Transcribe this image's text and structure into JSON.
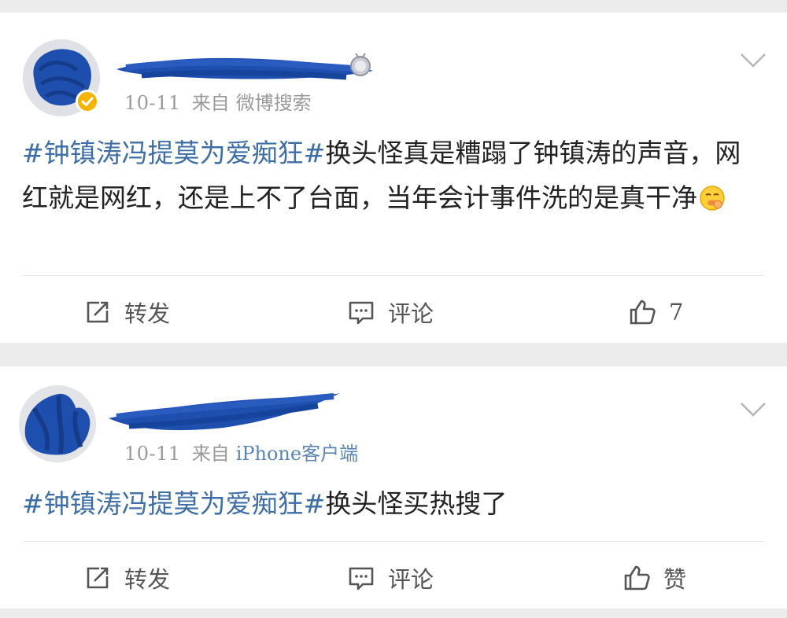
{
  "posts": [
    {
      "time": "10-11",
      "from_label": "来自",
      "source": "微博搜索",
      "content_tag": "#钟镇涛冯提莫为爱痴狂#",
      "content_text": "换头怪真是糟蹋了钟镇涛的声音，网红就是网红，还是上不了台面，当年会计事件洗的是真干净",
      "actions": {
        "repost": "转发",
        "comment": "评论",
        "like": "7"
      }
    },
    {
      "time": "10-11",
      "from_label": "来自",
      "source": "iPhone客户端",
      "content_tag": "#钟镇涛冯提莫为爱痴狂#",
      "content_text": "换头怪买热搜了",
      "actions": {
        "repost": "转发",
        "comment": "评论",
        "like": "赞"
      }
    }
  ],
  "colors": {
    "tag": "#3e6ea6",
    "source_link": "#5b85b3",
    "meta": "#9a9a9a",
    "redaction": "#1f4fae",
    "verified_badge": "#f6b400"
  },
  "icons": [
    "repost-icon",
    "comment-icon",
    "like-icon",
    "chevron-down-icon",
    "verified-icon",
    "medal-icon",
    "emoji-icon"
  ]
}
